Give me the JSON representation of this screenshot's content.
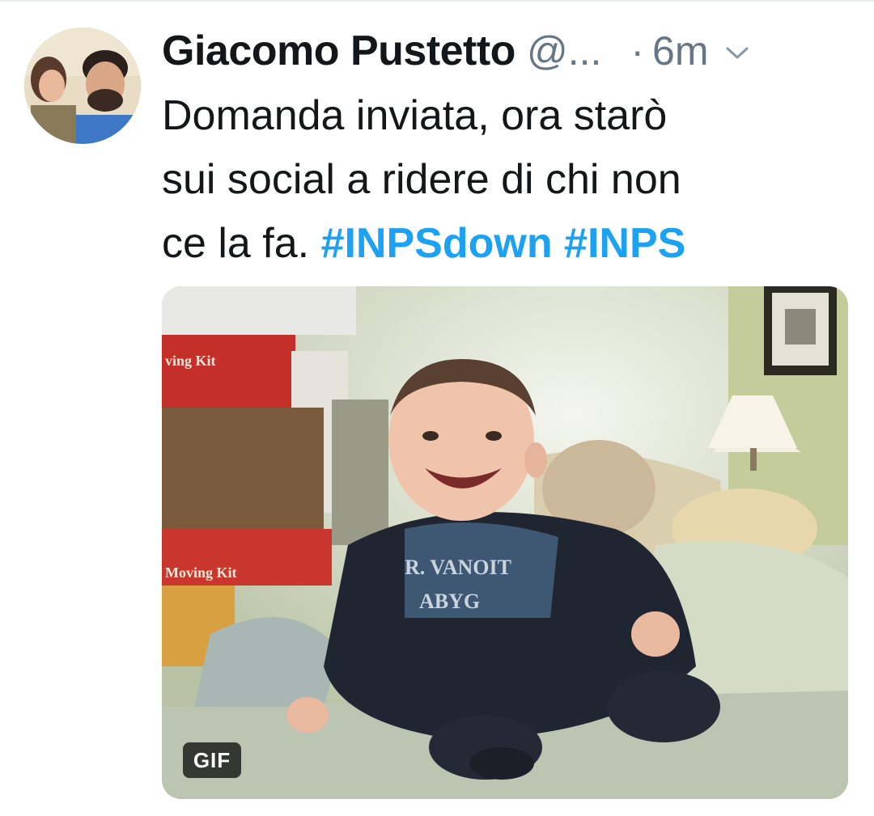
{
  "tweet": {
    "author_name": "Giacomo Pustetto",
    "author_handle": "@...",
    "separator": "·",
    "time": "6m",
    "menu_icon": "chevron-down-icon",
    "text_lines": [
      "Domanda inviata, ora starò",
      "sui social a ridere di chi non"
    ],
    "text_last_plain": "ce la fa. ",
    "hashtags": [
      "#INPSdown",
      "#INPS"
    ]
  },
  "media": {
    "badge": "GIF",
    "box_text_top": "ving Kit",
    "box_text_bottom": "Moving Kit",
    "shirt_line_1": "R. VANOIT",
    "shirt_line_2": "ABYG"
  },
  "colors": {
    "text": "#14171a",
    "secondary": "#657786",
    "link": "#1da1f2"
  }
}
